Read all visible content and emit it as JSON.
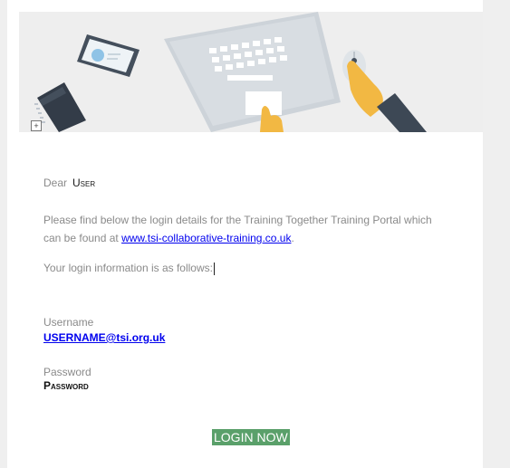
{
  "email": {
    "greeting_label": "Dear",
    "recipient_name": "User",
    "paragraph_text": "Please find below the login details for the Training Together Training Portal which can be found at ",
    "portal_link": "www.tsi-collaborative-training.co.uk",
    "paragraph_end": ".",
    "intro_text": "Your login information is as follows:",
    "username_label": "Username",
    "username_value": "USERNAME@tsi.org.uk",
    "password_label": "Password",
    "password_value": "Password",
    "login_button": "LOGIN NOW"
  },
  "icons": {
    "hero": "laptop-workspace-illustration",
    "table_handle": "move-table-icon"
  },
  "colors": {
    "link": "#0000ee",
    "button_bg": "#5aa06a",
    "body_text": "#8a8a8a"
  }
}
